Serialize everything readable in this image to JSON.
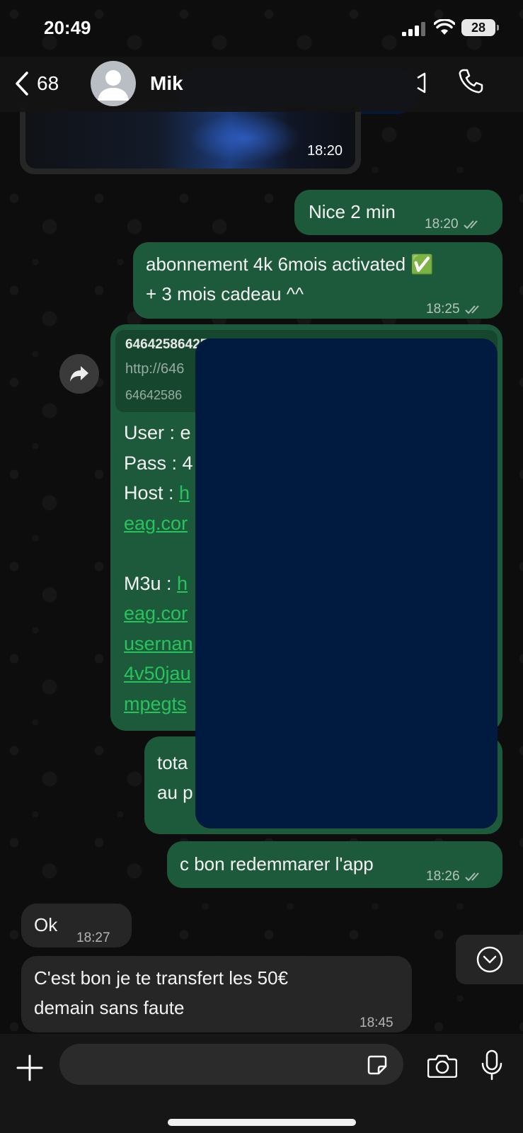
{
  "status_bar": {
    "time": "20:49",
    "battery": "28"
  },
  "header": {
    "back_count": "68",
    "contact_name": "Mik"
  },
  "messages": {
    "image": {
      "time": "18:20"
    },
    "nice": {
      "text": "Nice 2 min",
      "time": "18:20"
    },
    "abonnement": {
      "line1": "abonnement 4k 6mois activated ✅",
      "line2": "+ 3 mois cadeau ^^",
      "time": "18:25"
    },
    "credentials": {
      "preview_title": "646425864257",
      "preview_url": "http://646",
      "preview_sub": "64642586",
      "user": "User : e",
      "pass": "Pass : 4",
      "host_label": "Host : ",
      "host_link1": "h",
      "host_link2": "eag.cor",
      "m3u_label": "M3u : ",
      "m3u_link1": "h",
      "m3u_link2": "eag.cor",
      "m3u_link3": "usernan",
      "m3u_link4": "4v50jau",
      "m3u_link5": "mpegts"
    },
    "tota": {
      "line1": "tota",
      "line2": "au p"
    },
    "redemarrer": {
      "text": "c bon redemmarer l'app",
      "time": "18:26"
    },
    "ok": {
      "text": "Ok",
      "time": "18:27"
    },
    "transfert": {
      "line1": "C'est bon je te transfert les 50€",
      "line2": "demain sans faute",
      "time": "18:45"
    }
  },
  "composer": {
    "placeholder": ""
  },
  "colors": {
    "outgoing": "#1d5a3b",
    "incoming": "#262626",
    "link": "#27c35c",
    "redaction": "#001b3f"
  }
}
